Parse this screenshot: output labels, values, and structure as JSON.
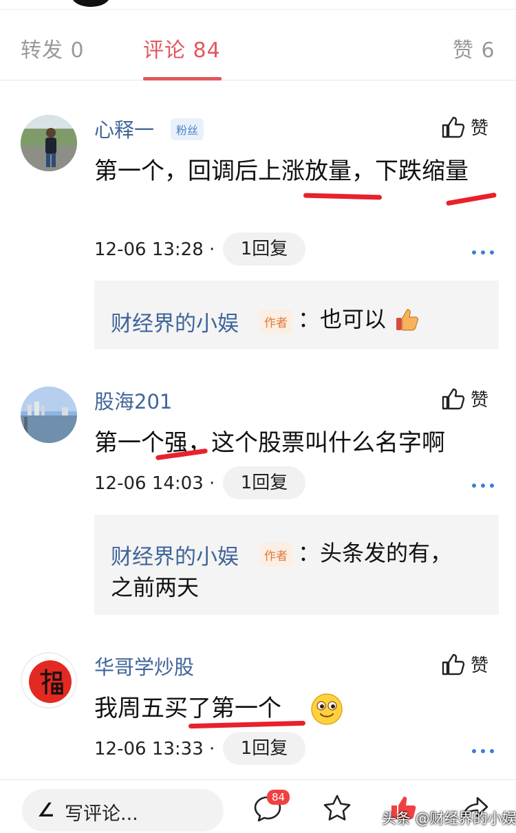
{
  "tabs": [
    {
      "label": "转发 0"
    },
    {
      "label": "评论 84"
    },
    {
      "label": "赞 6"
    }
  ],
  "colors": {
    "accent": "#e0585e",
    "username": "#406599",
    "reply_box": "#f4f4f4",
    "highlight_stroke": "#e8212a"
  },
  "comments": [
    {
      "username": "心释一",
      "badge": "粉丝",
      "like_label": "赞",
      "text": "第一个，回调后上涨放量，下跌缩量",
      "timestamp": "12-06 13:28 ·",
      "reply_count": "1回复",
      "reply": {
        "author": "财经界的小娱",
        "author_badge": "作者",
        "text": "：也可以",
        "emoji": "thumbs-up-emoji"
      }
    },
    {
      "username": "股海201",
      "like_label": "赞",
      "text": "第一个强，这个股票叫什么名字啊",
      "timestamp": "12-06 14:03 ·",
      "reply_count": "1回复",
      "reply": {
        "author": "财经界的小娱",
        "author_badge": "作者",
        "text": "：头条发的有，",
        "text2": "之前两天"
      }
    },
    {
      "username": "华哥学炒股",
      "like_label": "赞",
      "text": "我周五买了第一个",
      "emoji": "smiley-emoji",
      "timestamp": "12-06 13:33 ·",
      "reply_count": "1回复"
    }
  ],
  "bottom_bar": {
    "write_placeholder": "写评论...",
    "comment_count": "84",
    "icons": [
      "pen-icon",
      "comment-icon",
      "star-icon",
      "like-icon",
      "share-icon"
    ],
    "watermark": "头条 @财经界的小娱"
  }
}
